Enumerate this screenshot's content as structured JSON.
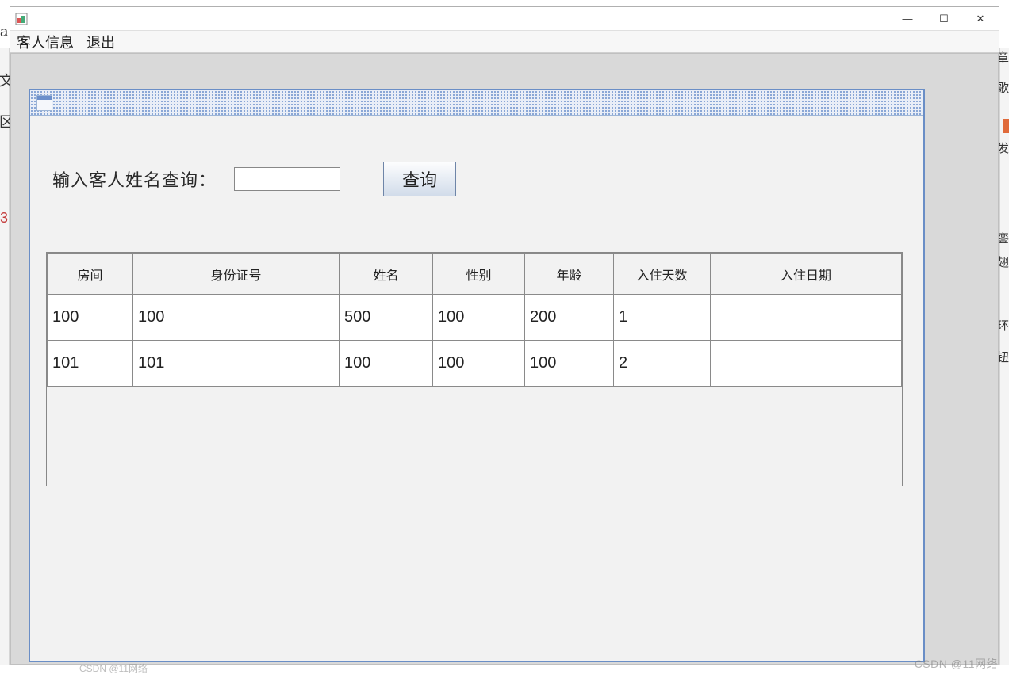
{
  "window": {
    "controls": {
      "min": "—",
      "max": "☐",
      "close": "✕"
    }
  },
  "menu": {
    "guest_info": "客人信息",
    "exit": "退出"
  },
  "search": {
    "label": "输入客人姓名查询：",
    "value": "",
    "button": "查询"
  },
  "table": {
    "columns": [
      "房间",
      "身份证号",
      "姓名",
      "性别",
      "年龄",
      "入住天数",
      "入住日期"
    ],
    "rows": [
      {
        "room": "100",
        "id_no": "100",
        "name": "500",
        "gender": "100",
        "age": "200",
        "days": "1",
        "date": ""
      },
      {
        "room": "101",
        "id_no": "101",
        "name": "100",
        "gender": "100",
        "age": "100",
        "days": "2",
        "date": ""
      }
    ]
  },
  "background": {
    "left_chars": [
      "a",
      "文",
      "区",
      "",
      "3"
    ],
    "right_chars": [
      "章",
      "歌",
      "发",
      "銮",
      "翅",
      "环",
      "钮"
    ]
  },
  "watermark": "CSDN @11网络",
  "bottom_clip": "CSDN @11网络"
}
